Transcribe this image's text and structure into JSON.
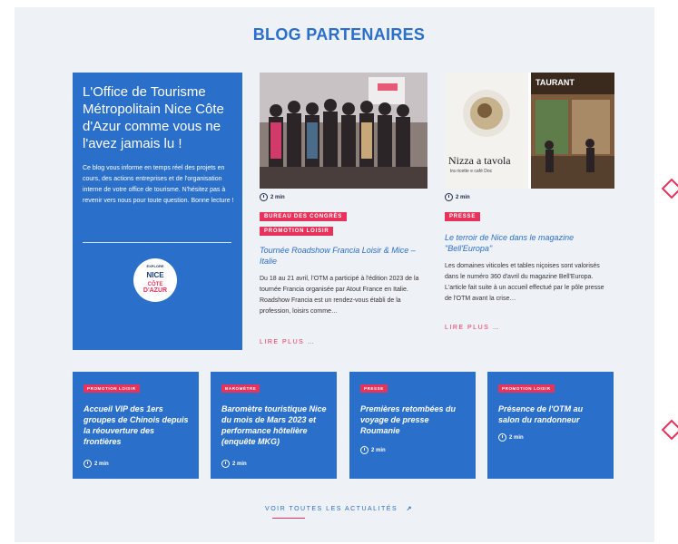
{
  "section_title": "BLOG PARTENAIRES",
  "intro": {
    "heading": "L'Office de Tourisme Métropolitain Nice Côte d'Azur comme vous ne l'avez jamais lu !",
    "body": "Ce blog vous informe en temps réel des projets en cours, des actions entreprises et de l'organisation interne de votre office de tourisme. N'hésitez pas à revenir vers nous pour toute question. Bonne lecture !",
    "logo": {
      "line1": "EXPLORE",
      "line2a": "NICE",
      "line2b": "CÔTE",
      "line3": "D'AZUR"
    }
  },
  "posts": [
    {
      "read_time": "2 min",
      "tags": [
        "BUREAU DES CONGRÈS",
        "PROMOTION LOISIR"
      ],
      "title": "Tournée Roadshow Francia Loisir & Mice – Italie",
      "excerpt": "Du 18 au 21 avril, l'OTM a participé à l'édition 2023 de la tournée Francia organisée par Atout France en Italie.  Roadshow Francia est un rendez-vous établi de la profession, loisirs comme…",
      "read_more": "LIRE PLUS …"
    },
    {
      "read_time": "2 min",
      "tags": [
        "PRESSE"
      ],
      "title": "Le terroir de Nice dans le magazine \"Bell'Europa\"",
      "excerpt": "Les domaines viticoles et tables niçoises sont valorisés dans le numéro 360 d'avril du magazine Bell'Europa. L'article fait suite à un accueil effectué par le pôle presse de l'OTM avant la crise…",
      "read_more": "LIRE PLUS …",
      "image_caption": "Nizza a tavola",
      "image_subcaption": "tra ricette e café Doc"
    }
  ],
  "small_posts": [
    {
      "tag": "PROMOTION LOISIR",
      "title": "Accueil VIP des 1ers groupes de Chinois depuis la réouverture des frontières",
      "read_time": "2 min"
    },
    {
      "tag": "BAROMÈTRE",
      "title": "Baromètre touristique Nice du mois de Mars 2023 et performance hôtelière (enquête MKG)",
      "read_time": "2 min"
    },
    {
      "tag": "PRESSE",
      "title": "Premières retombées du voyage de presse Roumanie",
      "read_time": "2 min"
    },
    {
      "tag": "PROMOTION LOISIR",
      "title": "Présence de l'OTM au salon du randonneur",
      "read_time": "2 min"
    }
  ],
  "all_news": "VOIR TOUTES LES ACTUALITÉS",
  "all_news_arrow": "↗",
  "colors": {
    "primary": "#2a6fc9",
    "accent": "#e8325a",
    "panel_bg": "#eef1f6"
  }
}
